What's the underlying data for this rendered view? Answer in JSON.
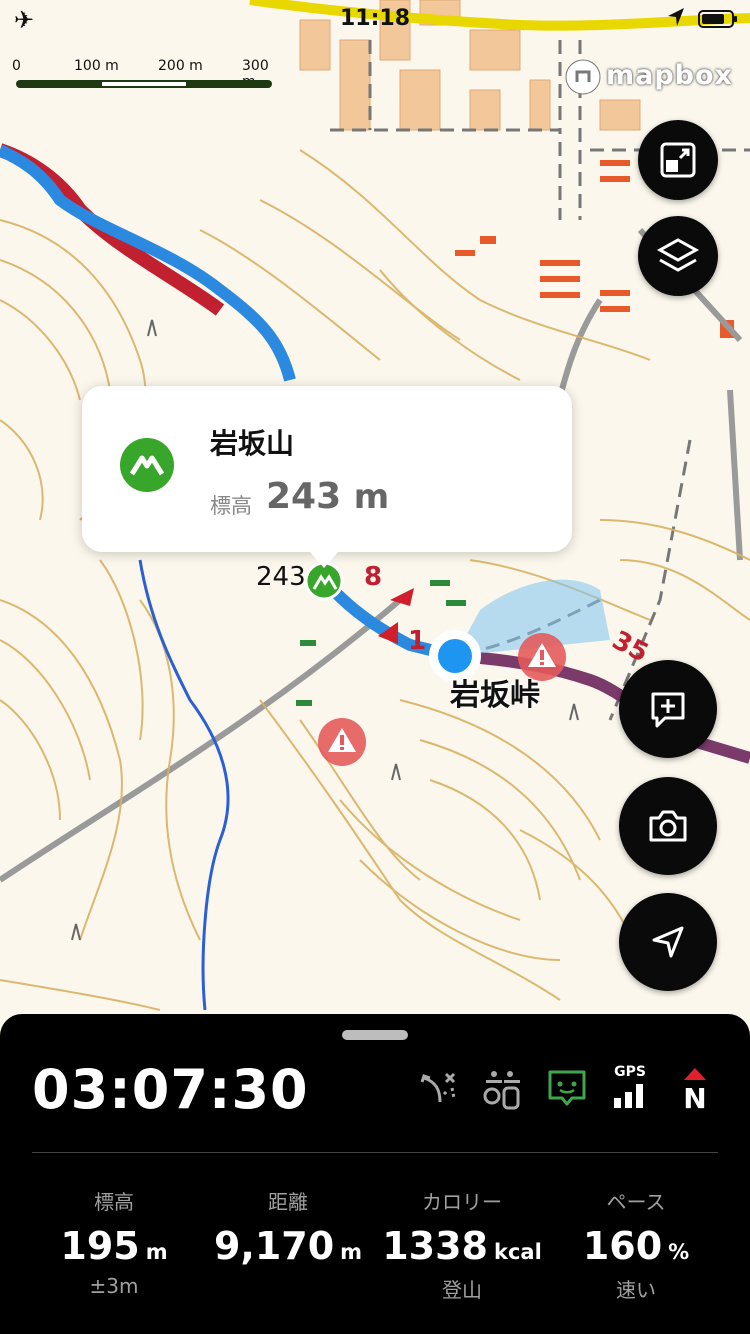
{
  "status_bar": {
    "time": "11:18"
  },
  "scale_bar": {
    "ticks": [
      "0",
      "100 m",
      "200 m",
      "300 m"
    ]
  },
  "attribution": {
    "text": "mapbox"
  },
  "map_labels": {
    "pass_name": "岩坂峠",
    "peak_height_text": "243",
    "route_marker_a": "8",
    "route_marker_b": "1",
    "route_marker_c": "35"
  },
  "popup": {
    "title": "岩坂山",
    "elevation_label": "標高",
    "elevation_value": "243",
    "elevation_unit": "m"
  },
  "panel": {
    "elapsed_time": "03:07:30",
    "gps_label": "GPS",
    "compass_label": "N",
    "stats": [
      {
        "label": "標高",
        "value": "195",
        "unit": "m",
        "sub": "±3m"
      },
      {
        "label": "距離",
        "value": "9,170",
        "unit": "m",
        "sub": ""
      },
      {
        "label": "カロリー",
        "value": "1338",
        "unit": "kcal",
        "sub": "登山"
      },
      {
        "label": "ペース",
        "value": "160",
        "unit": "%",
        "sub": "速い"
      }
    ]
  },
  "colors": {
    "route": "#2b8ae0",
    "track": "#7a3a6a",
    "contour": "#d8b262",
    "peak_green": "#38a62a",
    "warning": "#e35b5b",
    "location": "#1f95f2"
  },
  "icons": [
    "airplane-icon",
    "location-arrow-icon",
    "battery-icon",
    "fit-screen-icon",
    "layers-icon",
    "add-memo-icon",
    "camera-icon",
    "navigate-icon",
    "route-icon",
    "hikers-icon",
    "chat-icon",
    "gps-icon",
    "compass-icon",
    "mountain-icon",
    "warning-icon"
  ]
}
